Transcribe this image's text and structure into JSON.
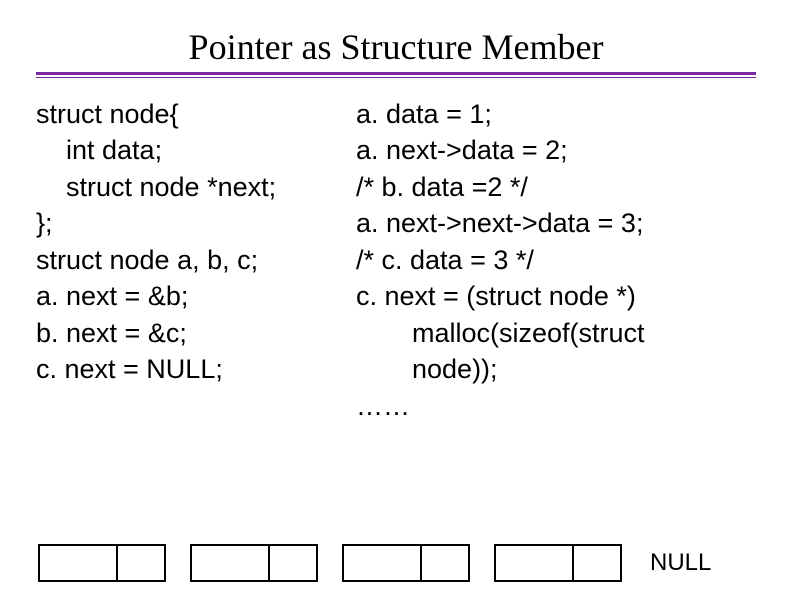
{
  "title": "Pointer as Structure Member",
  "left": {
    "l1": "struct node{",
    "l2": "int data;",
    "l3": "struct node *next;",
    "l4": "};",
    "l5": "struct node a, b, c;",
    "l6": "a. next = &b;",
    "l7": "b. next = &c;",
    "l8": "c. next = NULL;"
  },
  "right": {
    "r1": "a. data = 1;",
    "r2": "a. next->data = 2;",
    "r3": "/* b. data =2 */",
    "r4": "a. next->next->data = 3;",
    "r5": "/* c. data = 3 */",
    "r6": "c. next = (struct node *)",
    "r7": "malloc(sizeof(struct",
    "r8": "node));",
    "r9": "……"
  },
  "diagram": {
    "null_label": "NULL"
  }
}
